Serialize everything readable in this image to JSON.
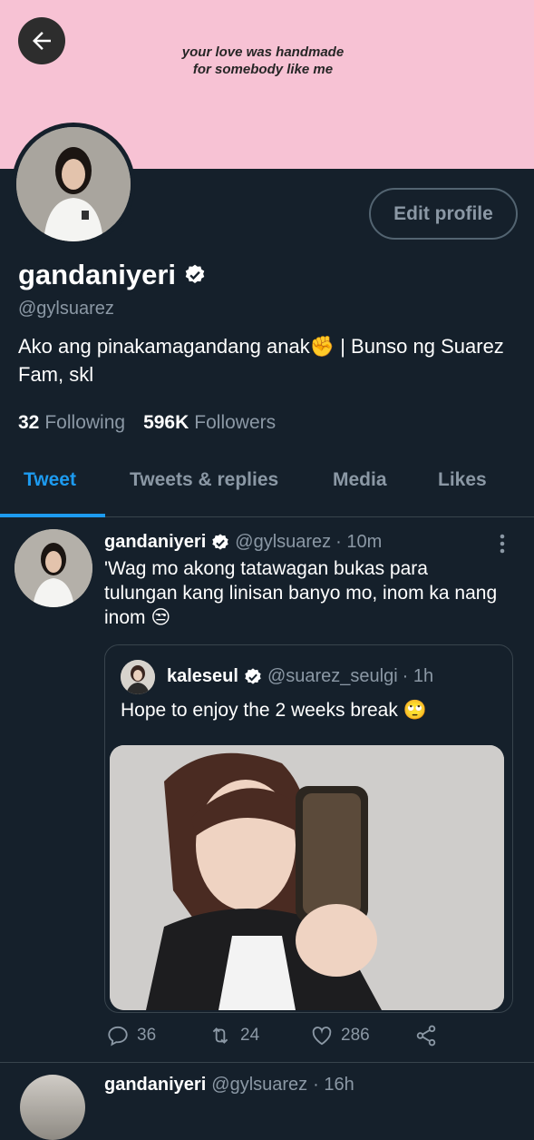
{
  "banner": {
    "text_line1": "your love was handmade",
    "text_line2": "for somebody like me"
  },
  "profile": {
    "name": "gandaniyeri",
    "handle": "@gylsuarez",
    "bio": "Ako ang pinakamagandang anak✊ | Bunso ng Suarez Fam, skl",
    "following_count": "32",
    "following_label": "Following",
    "followers_count": "596K",
    "followers_label": "Followers",
    "edit_button": "Edit profile"
  },
  "tabs": [
    {
      "label": "Tweet",
      "active": true
    },
    {
      "label": "Tweets & replies",
      "active": false
    },
    {
      "label": "Media",
      "active": false
    },
    {
      "label": "Likes",
      "active": false
    }
  ],
  "tweet": {
    "name": "gandaniyeri",
    "handle": "@gylsuarez",
    "time": "· 10m",
    "text": "'Wag mo akong tatawagan bukas para tulungan kang linisan banyo mo, inom ka nang inom 😒",
    "quote": {
      "name": "kaleseul",
      "handle": "@suarez_seulgi",
      "time": "· 1h",
      "text": "Hope to enjoy the 2 weeks break 🙄"
    },
    "actions": {
      "replies": "36",
      "retweets": "24",
      "likes": "286"
    }
  },
  "next_tweet": {
    "name": "gandaniyeri",
    "handle": "@gylsuarez",
    "time": "· 16h"
  },
  "colors": {
    "background": "#15202b",
    "accent": "#1d9bf0",
    "banner": "#f7c2d4",
    "muted": "#8b98a5"
  },
  "icons": [
    "back-arrow-icon",
    "verified-icon",
    "more-icon",
    "reply-icon",
    "retweet-icon",
    "like-icon",
    "share-icon"
  ]
}
